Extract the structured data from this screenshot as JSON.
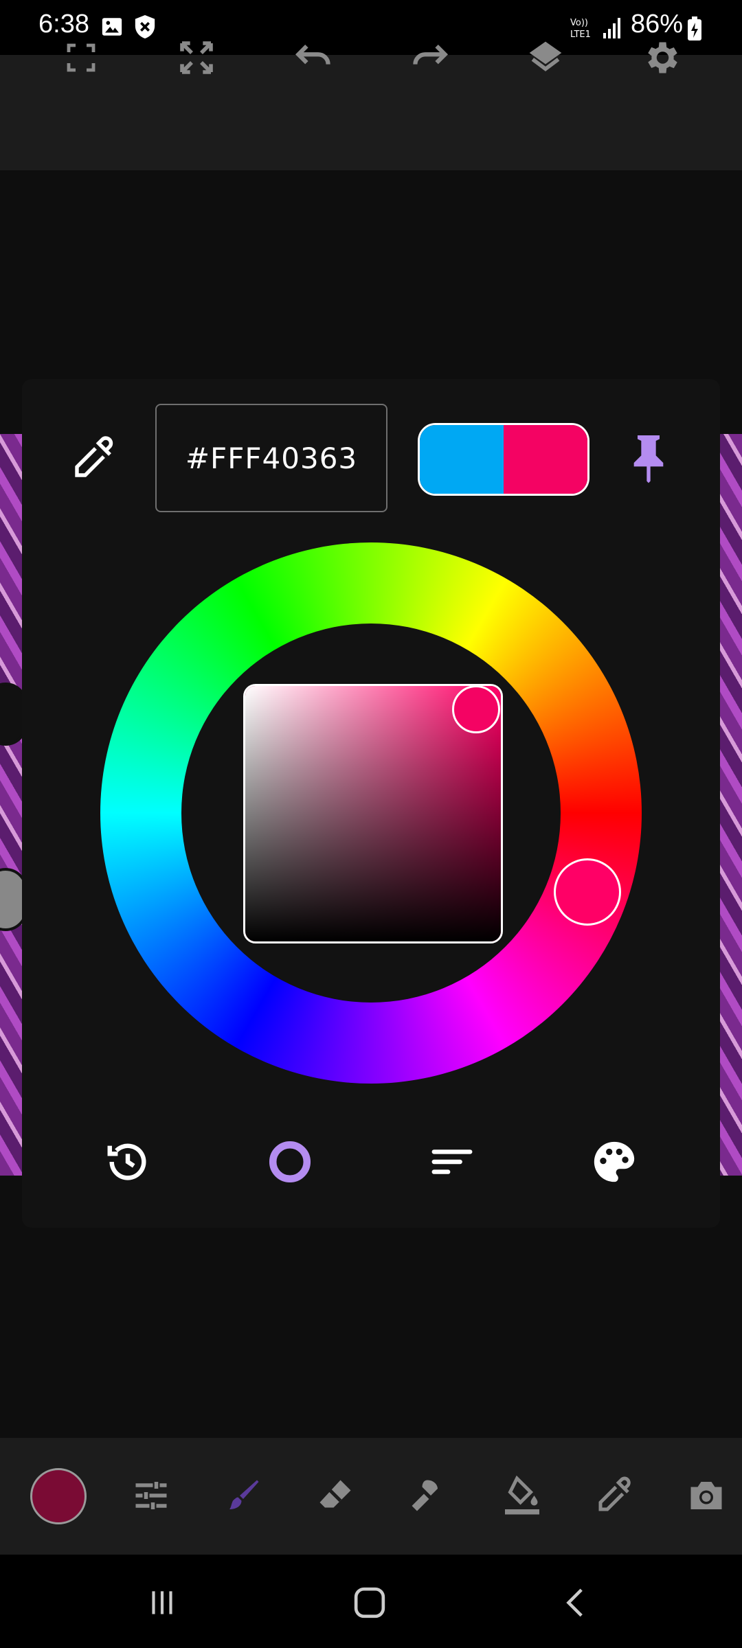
{
  "status_bar": {
    "time": "6:38",
    "network": "VoLTE1",
    "battery": "86%"
  },
  "colors": {
    "accent": "#b48cf0",
    "old_color": "#00a8f3",
    "new_color": "#f40363",
    "current_brush_color": "#7a0b34",
    "hue_color": "#ff0066",
    "toolbar_icon": "#8a8a8a"
  },
  "top_toolbar": {
    "items": [
      "fullscreen-icon",
      "fit-screen-icon",
      "undo-icon",
      "redo-icon",
      "layers-icon",
      "gear-icon"
    ]
  },
  "color_picker": {
    "hex_value": "#FFF40363",
    "hue_degrees": 338,
    "saturation": 0.99,
    "value": 0.96,
    "tabs": [
      "history-icon",
      "wheel-icon",
      "sliders-icon",
      "palette-icon"
    ],
    "active_tab": "wheel-icon"
  },
  "bottom_toolbar": {
    "items": [
      "adjust-icon",
      "brush-icon",
      "eraser-icon",
      "smudge-icon",
      "fill-icon",
      "eyedropper-icon",
      "camera-icon"
    ],
    "active_tool": "brush-icon"
  },
  "nav_bar": {
    "items": [
      "recents-icon",
      "home-icon",
      "back-icon"
    ]
  }
}
